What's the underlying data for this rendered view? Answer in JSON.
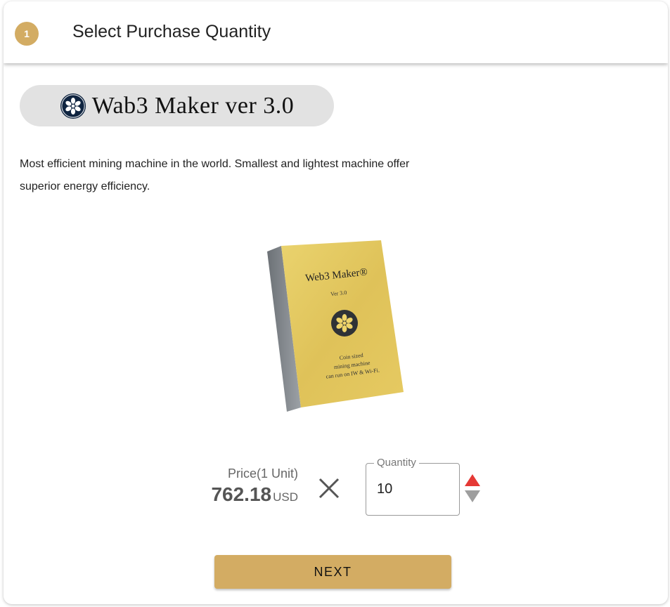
{
  "step": {
    "number": "1",
    "title": "Select Purchase Quantity",
    "badge_color": "#d3ac63"
  },
  "product": {
    "logo_icon": "flower-logo-icon",
    "name": "Wab3 Maker ver 3.0",
    "description": "Most efficient mining machine in the world. Smallest and lightest machine offer superior energy efficiency.",
    "image_alt": "Web3 Maker product box",
    "box_text": {
      "brand": "Web3 Maker®",
      "version": "Ver 3.0",
      "tagline": [
        "Coin sized",
        "mining machine",
        "can run on IW & Wi-Fi."
      ]
    }
  },
  "price": {
    "label": "Price(1 Unit)",
    "value": "762.18",
    "currency": "USD"
  },
  "multiply_icon": "times-icon",
  "quantity": {
    "label": "Quantity",
    "value": "10",
    "increment_icon": "triangle-up-icon",
    "decrement_icon": "triangle-down-icon",
    "increment_color": "#e53935",
    "decrement_color": "#9e9e9e"
  },
  "actions": {
    "next_label": "NEXT",
    "accent_color": "#d3ac63"
  }
}
